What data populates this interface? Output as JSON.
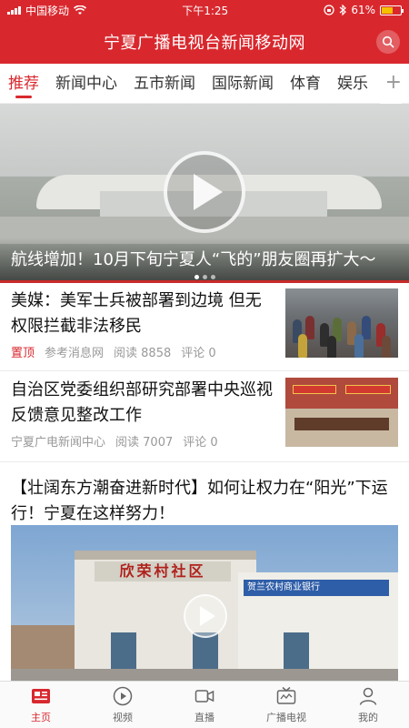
{
  "status_bar": {
    "carrier": "中国移动",
    "time": "下午1:25",
    "battery": "61%",
    "battery_level": 0.61
  },
  "header": {
    "title": "宁夏广播电视台新闻移动网"
  },
  "tabs": [
    {
      "label": "推荐",
      "active": true
    },
    {
      "label": "新闻中心",
      "active": false
    },
    {
      "label": "五市新闻",
      "active": false
    },
    {
      "label": "国际新闻",
      "active": false
    },
    {
      "label": "体育",
      "active": false
    },
    {
      "label": "娱乐",
      "active": false
    }
  ],
  "tab_add": "+",
  "hero": {
    "caption": "航线增加！10月下旬宁夏人“飞的”朋友圈再扩大～"
  },
  "news": [
    {
      "headline": "美媒：美军士兵被部署到边境 但无权限拦截非法移民",
      "pin": "置顶",
      "source": "参考消息网",
      "reads": "阅读 8858",
      "comments": "评论 0"
    },
    {
      "headline": "自治区党委组织部研究部署中央巡视反馈意见整改工作",
      "source": "宁夏广电新闻中心",
      "reads": "阅读 7007",
      "comments": "评论 0"
    }
  ],
  "feature": {
    "headline": "【壮阔东方潮奋进新时代】如何让权力在“阳光”下运行！宁夏在这样努力！",
    "sign_text": "欣荣村社区",
    "bank_text": "贺兰农村商业银行"
  },
  "bottom_nav": [
    {
      "label": "主页",
      "icon": "home-news-icon",
      "active": true
    },
    {
      "label": "视频",
      "icon": "video-play-icon",
      "active": false
    },
    {
      "label": "直播",
      "icon": "live-camera-icon",
      "active": false
    },
    {
      "label": "广播电视",
      "icon": "tv-icon",
      "active": false
    },
    {
      "label": "我的",
      "icon": "user-icon",
      "active": false
    }
  ],
  "colors": {
    "brand_red": "#d8282e",
    "text_muted": "#999999"
  }
}
